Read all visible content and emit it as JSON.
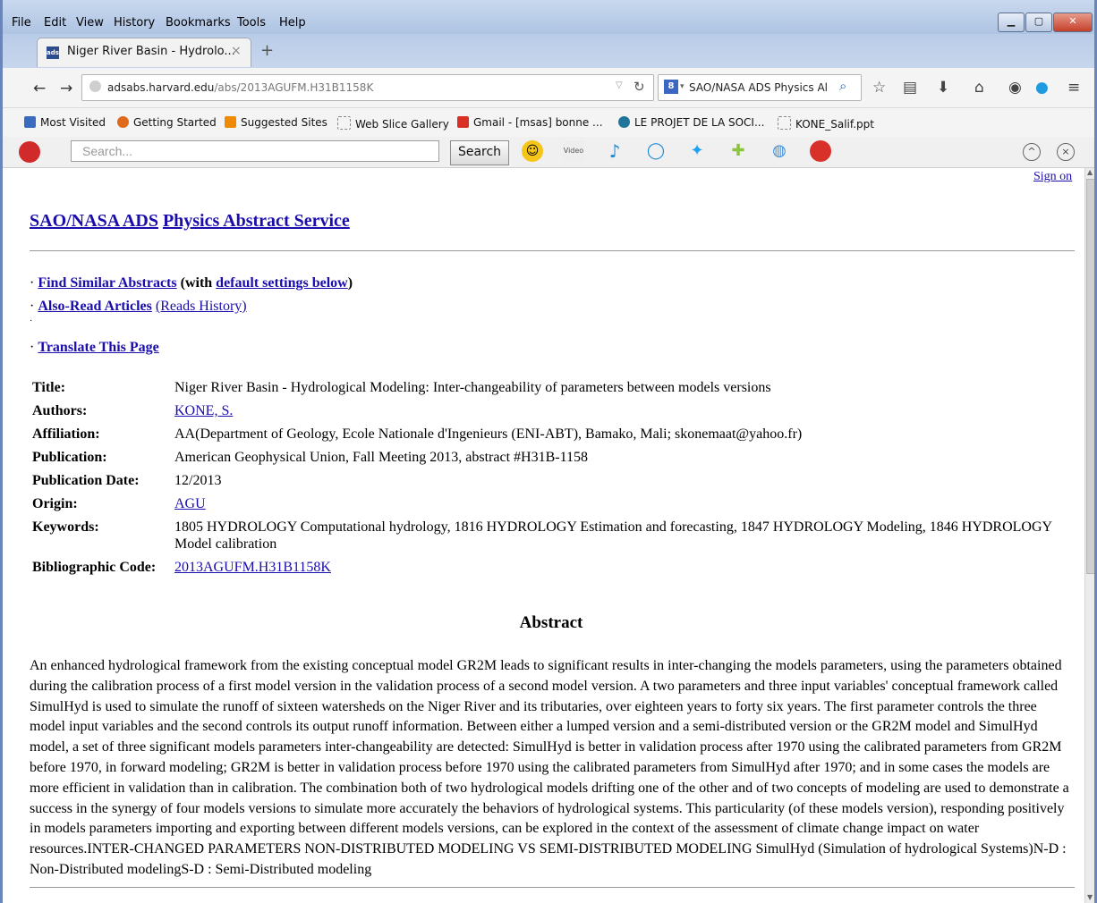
{
  "menubar": {
    "file": "File",
    "edit": "Edit",
    "view": "View",
    "history": "History",
    "bookmarks": "Bookmarks",
    "tools": "Tools",
    "help": "Help"
  },
  "tab": {
    "title": "Niger River Basin - Hydrolo...",
    "favicon": "ads",
    "close": "×",
    "new": "+"
  },
  "nav": {
    "back": "←",
    "forward": "→",
    "url_host": "adsabs.harvard.edu",
    "url_path": "/abs/2013AGUFM.H31B1158K",
    "search_value": "SAO/NASA ADS Physics Al",
    "search_engine_icon": "8"
  },
  "bookmarks": [
    {
      "label": "Most Visited",
      "color": "#3b6bbf"
    },
    {
      "label": "Getting Started",
      "color": "#e06a1c"
    },
    {
      "label": "Suggested Sites",
      "color": "#f08a00"
    },
    {
      "label": "Web Slice Gallery",
      "color": "#ffffff"
    },
    {
      "label": "Gmail - [msas] bonne ...",
      "color": "#d93025"
    },
    {
      "label": "LE PROJET DE LA SOCI...",
      "color": "#21759b"
    },
    {
      "label": "KONE_Salif.ppt",
      "color": "#ffffff"
    }
  ],
  "addon": {
    "search_placeholder": "Search...",
    "search_button": "Search",
    "video_label": "Video"
  },
  "page": {
    "signon": "Sign on",
    "header_link1": "SAO/NASA ADS",
    "header_link2": "Physics Abstract Service",
    "find_similar": "Find Similar Abstracts",
    "with_open": "(with",
    "default_settings": "default settings below",
    "with_close": ")",
    "also_read": "Also-Read Articles",
    "reads_history": "(Reads History)",
    "translate": "Translate This Page",
    "bullet": "·"
  },
  "meta": [
    {
      "label": "Title:",
      "value": "Niger River Basin - Hydrological Modeling: Inter-changeability of parameters between models versions",
      "link": false
    },
    {
      "label": "Authors:",
      "value": "KONE, S.",
      "link": true
    },
    {
      "label": "Affiliation:",
      "value": "AA(Department of Geology, Ecole Nationale d'Ingenieurs (ENI-ABT), Bamako, Mali; skonemaat@yahoo.fr)",
      "link": false
    },
    {
      "label": "Publication:",
      "value": "American Geophysical Union, Fall Meeting 2013, abstract #H31B-1158",
      "link": false
    },
    {
      "label": "Publication Date:",
      "value": "12/2013",
      "link": false
    },
    {
      "label": "Origin:",
      "value": "AGU",
      "link": true
    },
    {
      "label": "Keywords:",
      "value": "1805 HYDROLOGY Computational hydrology, 1816 HYDROLOGY Estimation and forecasting, 1847 HYDROLOGY Modeling, 1846 HYDROLOGY Model calibration",
      "link": false
    },
    {
      "label": "Bibliographic Code:",
      "value": "2013AGUFM.H31B1158K",
      "link": true
    }
  ],
  "abstract": {
    "title": "Abstract",
    "text": "An enhanced hydrological framework from the existing conceptual model GR2M leads to significant results in inter-changing the models parameters, using the parameters obtained during the calibration process of a first model version in the validation process of a second model version. A two parameters and three input variables' conceptual framework called SimulHyd is used to simulate the runoff of sixteen watersheds on the Niger River and its tributaries, over eighteen years to forty six years. The first parameter controls the three model input variables and the second controls its output runoff information. Between either a lumped version and a semi-distributed version or the GR2M model and SimulHyd model, a set of three significant models parameters inter-changeability are detected: SimulHyd is better in validation process after 1970 using the calibrated parameters from GR2M before 1970, in forward modeling; GR2M is better in validation process before 1970 using the calibrated parameters from SimulHyd after 1970; and in some cases the models are more efficient in validation than in calibration. The combination both of two hydrological models drifting one of the other and of two concepts of modeling are used to demonstrate a success in the synergy of four models versions to simulate more accurately the behaviors of hydrological systems. This particularity (of these models version), responding positively in models parameters importing and exporting between different models versions, can be explored in the context of the assessment of climate change impact on water resources.INTER-CHANGED PARAMETERS NON-DISTRIBUTED MODELING VS SEMI-DISTRIBUTED MODELING SimulHyd (Simulation of hydrological Systems)N-D : Non-Distributed modelingS-D : Semi-Distributed modeling"
  }
}
